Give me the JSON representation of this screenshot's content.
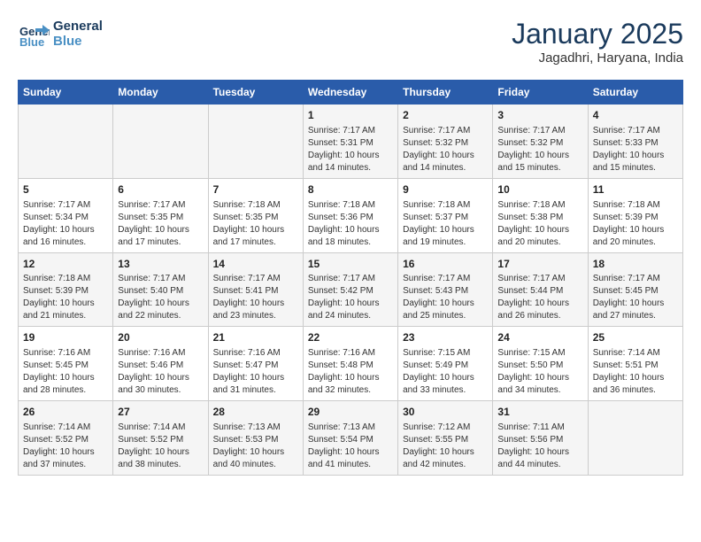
{
  "header": {
    "logo_line1": "General",
    "logo_line2": "Blue",
    "month": "January 2025",
    "location": "Jagadhri, Haryana, India"
  },
  "weekdays": [
    "Sunday",
    "Monday",
    "Tuesday",
    "Wednesday",
    "Thursday",
    "Friday",
    "Saturday"
  ],
  "weeks": [
    [
      {
        "day": "",
        "info": ""
      },
      {
        "day": "",
        "info": ""
      },
      {
        "day": "",
        "info": ""
      },
      {
        "day": "1",
        "info": "Sunrise: 7:17 AM\nSunset: 5:31 PM\nDaylight: 10 hours\nand 14 minutes."
      },
      {
        "day": "2",
        "info": "Sunrise: 7:17 AM\nSunset: 5:32 PM\nDaylight: 10 hours\nand 14 minutes."
      },
      {
        "day": "3",
        "info": "Sunrise: 7:17 AM\nSunset: 5:32 PM\nDaylight: 10 hours\nand 15 minutes."
      },
      {
        "day": "4",
        "info": "Sunrise: 7:17 AM\nSunset: 5:33 PM\nDaylight: 10 hours\nand 15 minutes."
      }
    ],
    [
      {
        "day": "5",
        "info": "Sunrise: 7:17 AM\nSunset: 5:34 PM\nDaylight: 10 hours\nand 16 minutes."
      },
      {
        "day": "6",
        "info": "Sunrise: 7:17 AM\nSunset: 5:35 PM\nDaylight: 10 hours\nand 17 minutes."
      },
      {
        "day": "7",
        "info": "Sunrise: 7:18 AM\nSunset: 5:35 PM\nDaylight: 10 hours\nand 17 minutes."
      },
      {
        "day": "8",
        "info": "Sunrise: 7:18 AM\nSunset: 5:36 PM\nDaylight: 10 hours\nand 18 minutes."
      },
      {
        "day": "9",
        "info": "Sunrise: 7:18 AM\nSunset: 5:37 PM\nDaylight: 10 hours\nand 19 minutes."
      },
      {
        "day": "10",
        "info": "Sunrise: 7:18 AM\nSunset: 5:38 PM\nDaylight: 10 hours\nand 20 minutes."
      },
      {
        "day": "11",
        "info": "Sunrise: 7:18 AM\nSunset: 5:39 PM\nDaylight: 10 hours\nand 20 minutes."
      }
    ],
    [
      {
        "day": "12",
        "info": "Sunrise: 7:18 AM\nSunset: 5:39 PM\nDaylight: 10 hours\nand 21 minutes."
      },
      {
        "day": "13",
        "info": "Sunrise: 7:17 AM\nSunset: 5:40 PM\nDaylight: 10 hours\nand 22 minutes."
      },
      {
        "day": "14",
        "info": "Sunrise: 7:17 AM\nSunset: 5:41 PM\nDaylight: 10 hours\nand 23 minutes."
      },
      {
        "day": "15",
        "info": "Sunrise: 7:17 AM\nSunset: 5:42 PM\nDaylight: 10 hours\nand 24 minutes."
      },
      {
        "day": "16",
        "info": "Sunrise: 7:17 AM\nSunset: 5:43 PM\nDaylight: 10 hours\nand 25 minutes."
      },
      {
        "day": "17",
        "info": "Sunrise: 7:17 AM\nSunset: 5:44 PM\nDaylight: 10 hours\nand 26 minutes."
      },
      {
        "day": "18",
        "info": "Sunrise: 7:17 AM\nSunset: 5:45 PM\nDaylight: 10 hours\nand 27 minutes."
      }
    ],
    [
      {
        "day": "19",
        "info": "Sunrise: 7:16 AM\nSunset: 5:45 PM\nDaylight: 10 hours\nand 28 minutes."
      },
      {
        "day": "20",
        "info": "Sunrise: 7:16 AM\nSunset: 5:46 PM\nDaylight: 10 hours\nand 30 minutes."
      },
      {
        "day": "21",
        "info": "Sunrise: 7:16 AM\nSunset: 5:47 PM\nDaylight: 10 hours\nand 31 minutes."
      },
      {
        "day": "22",
        "info": "Sunrise: 7:16 AM\nSunset: 5:48 PM\nDaylight: 10 hours\nand 32 minutes."
      },
      {
        "day": "23",
        "info": "Sunrise: 7:15 AM\nSunset: 5:49 PM\nDaylight: 10 hours\nand 33 minutes."
      },
      {
        "day": "24",
        "info": "Sunrise: 7:15 AM\nSunset: 5:50 PM\nDaylight: 10 hours\nand 34 minutes."
      },
      {
        "day": "25",
        "info": "Sunrise: 7:14 AM\nSunset: 5:51 PM\nDaylight: 10 hours\nand 36 minutes."
      }
    ],
    [
      {
        "day": "26",
        "info": "Sunrise: 7:14 AM\nSunset: 5:52 PM\nDaylight: 10 hours\nand 37 minutes."
      },
      {
        "day": "27",
        "info": "Sunrise: 7:14 AM\nSunset: 5:52 PM\nDaylight: 10 hours\nand 38 minutes."
      },
      {
        "day": "28",
        "info": "Sunrise: 7:13 AM\nSunset: 5:53 PM\nDaylight: 10 hours\nand 40 minutes."
      },
      {
        "day": "29",
        "info": "Sunrise: 7:13 AM\nSunset: 5:54 PM\nDaylight: 10 hours\nand 41 minutes."
      },
      {
        "day": "30",
        "info": "Sunrise: 7:12 AM\nSunset: 5:55 PM\nDaylight: 10 hours\nand 42 minutes."
      },
      {
        "day": "31",
        "info": "Sunrise: 7:11 AM\nSunset: 5:56 PM\nDaylight: 10 hours\nand 44 minutes."
      },
      {
        "day": "",
        "info": ""
      }
    ]
  ]
}
